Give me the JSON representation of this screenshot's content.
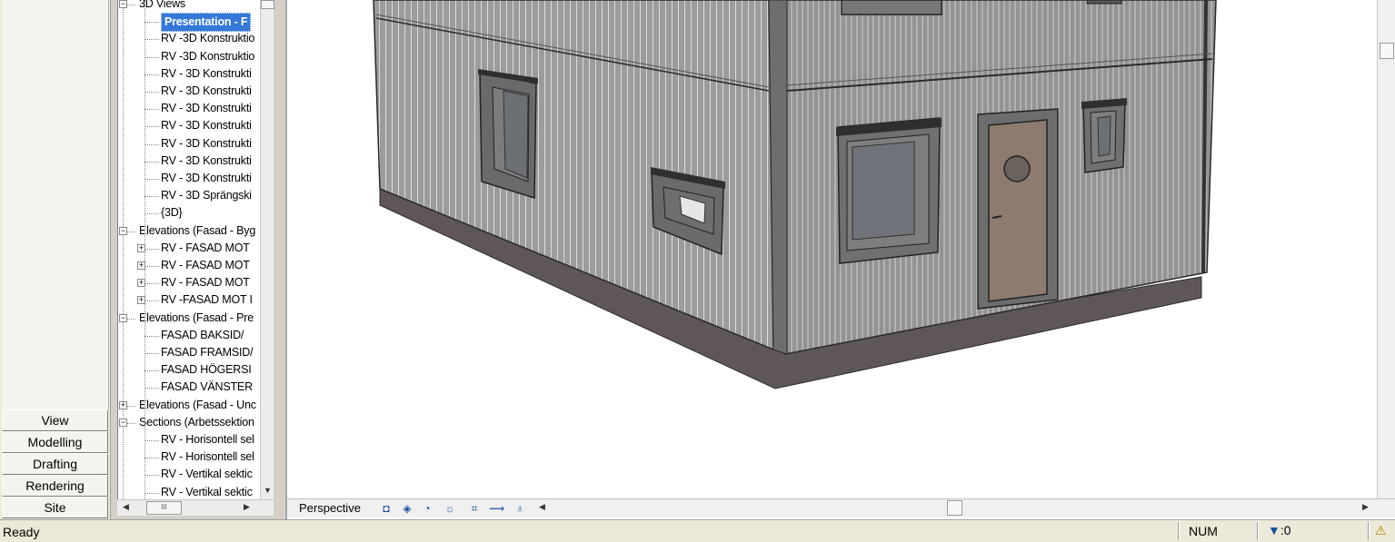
{
  "design_bar": {
    "tabs": [
      "View",
      "Modelling",
      "Drafting",
      "Rendering",
      "Site"
    ]
  },
  "project_browser": {
    "items": [
      {
        "text": "3D Views",
        "level": 0,
        "expander": "minus"
      },
      {
        "text": "Presentation - F",
        "level": 1,
        "selected": true
      },
      {
        "text": "RV -3D Konstruktio",
        "level": 1
      },
      {
        "text": "RV -3D Konstruktio",
        "level": 1
      },
      {
        "text": "RV - 3D Konstrukti",
        "level": 1
      },
      {
        "text": "RV - 3D Konstrukti",
        "level": 1
      },
      {
        "text": "RV - 3D Konstrukti",
        "level": 1
      },
      {
        "text": "RV - 3D Konstrukti",
        "level": 1
      },
      {
        "text": "RV - 3D Konstrukti",
        "level": 1
      },
      {
        "text": "RV - 3D Konstrukti",
        "level": 1
      },
      {
        "text": "RV - 3D Konstrukti",
        "level": 1
      },
      {
        "text": "RV - 3D Sprängski",
        "level": 1
      },
      {
        "text": "{3D}",
        "level": 1
      },
      {
        "text": "Elevations (Fasad - Byg",
        "level": 0,
        "expander": "minus"
      },
      {
        "text": "RV - FASAD MOT",
        "level": 1,
        "expander": "plus"
      },
      {
        "text": "RV - FASAD MOT",
        "level": 1,
        "expander": "plus"
      },
      {
        "text": "RV - FASAD MOT",
        "level": 1,
        "expander": "plus"
      },
      {
        "text": "RV -FASAD MOT I",
        "level": 1,
        "expander": "plus"
      },
      {
        "text": "Elevations (Fasad - Pre",
        "level": 0,
        "expander": "minus"
      },
      {
        "text": "FASAD BAKSID/",
        "level": 1
      },
      {
        "text": "FASAD FRAMSID/",
        "level": 1
      },
      {
        "text": "FASAD HÖGERSI",
        "level": 1
      },
      {
        "text": "FASAD VÄNSTER",
        "level": 1
      },
      {
        "text": "Elevations (Fasad - Unc",
        "level": 0,
        "expander": "plus"
      },
      {
        "text": "Sections (Arbetssektion",
        "level": 0,
        "expander": "minus"
      },
      {
        "text": "RV - Horisontell sel",
        "level": 1
      },
      {
        "text": "RV - Horisontell sel",
        "level": 1
      },
      {
        "text": "RV - Vertikal sektic",
        "level": 1
      },
      {
        "text": "RV - Vertikal sektic",
        "level": 1
      }
    ],
    "hscroll_thumb": "III"
  },
  "view_control_bar": {
    "view_type": "Perspective",
    "icons": [
      "detail-level-icon",
      "visual-style-icon",
      "shadows-icon",
      "sun-path-icon",
      "crop-region-icon",
      "show-crop-icon",
      "temporary-hide-icon"
    ]
  },
  "status_bar": {
    "message": "Ready",
    "num_lock": "NUM",
    "filter_count": ":0"
  },
  "colors": {
    "selection": "#3478d8",
    "wall": "#9a9a9a",
    "foundation": "#5e5656",
    "door": "#8c7a6c"
  }
}
